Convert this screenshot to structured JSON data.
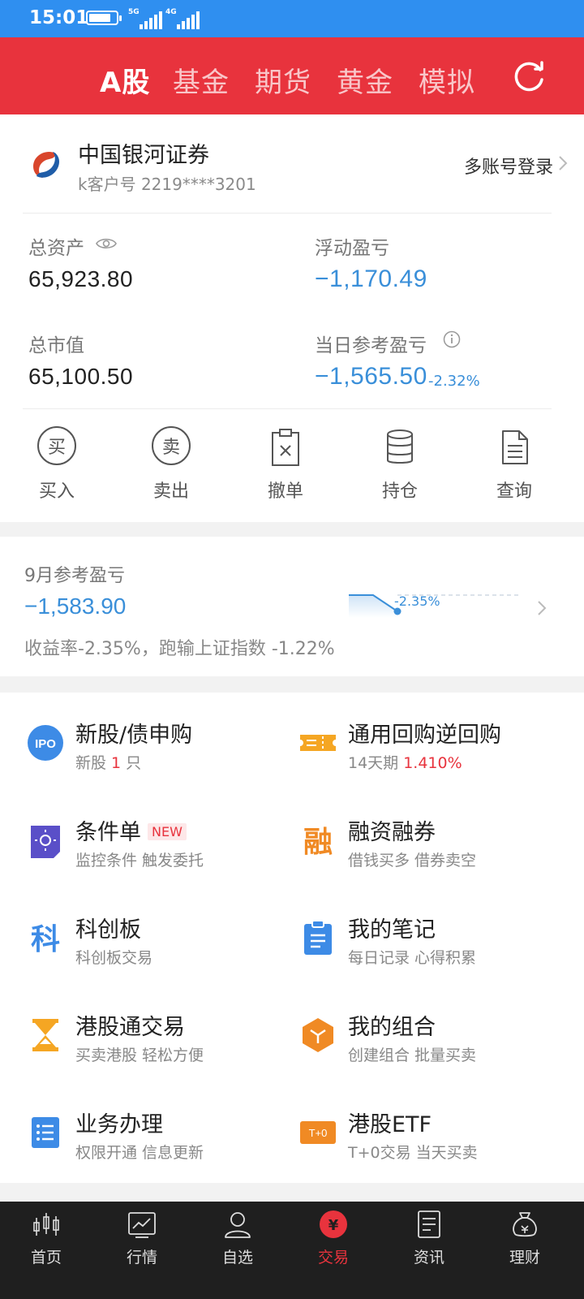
{
  "status_bar": {
    "time": "15:01",
    "network_1": "5G",
    "network_2": "4G",
    "battery_level": 0.8
  },
  "top_nav": {
    "tabs": [
      {
        "label": "A股",
        "active": true
      },
      {
        "label": "基金",
        "active": false
      },
      {
        "label": "期货",
        "active": false
      },
      {
        "label": "黄金",
        "active": false
      },
      {
        "label": "模拟",
        "active": false
      }
    ],
    "refresh_icon": "refresh-icon"
  },
  "account": {
    "broker_name": "中国银河证券",
    "account_id": "k客户号 2219****3201",
    "multi_login": "多账号登录",
    "total_assets_label": "总资产",
    "total_assets_value": "65,923.80",
    "floating_pl_label": "浮动盈亏",
    "floating_pl_value": "−1,170.49",
    "market_value_label": "总市值",
    "market_value_value": "65,100.50",
    "daily_pl_label": "当日参考盈亏",
    "daily_pl_value": "−1,565.50",
    "daily_pl_pct": "-2.32%"
  },
  "actions": [
    {
      "label": "买入",
      "glyph": "买"
    },
    {
      "label": "卖出",
      "glyph": "卖"
    },
    {
      "label": "撤单"
    },
    {
      "label": "持仓"
    },
    {
      "label": "查询"
    }
  ],
  "monthly": {
    "title": "9月参考盈亏",
    "value": "−1,583.90",
    "description": "收益率-2.35%，跑输上证指数 -1.22%",
    "spark_label": "-2.35%"
  },
  "services": [
    {
      "title": "新股/债申购",
      "sub_prefix": "新股 ",
      "sub_highlight": "1",
      "sub_suffix": " 只",
      "icon": "ipo-icon",
      "icon_text": "IPO"
    },
    {
      "title": "通用回购逆回购",
      "sub_prefix": "14天期 ",
      "sub_highlight": "1.410%",
      "sub_suffix": "",
      "icon": "ticket-icon"
    },
    {
      "title": "条件单",
      "badge": "NEW",
      "sub": "监控条件 触发委托",
      "icon": "condition-order-icon"
    },
    {
      "title": "融资融券",
      "sub": "借钱买多 借券卖空",
      "icon": "margin-icon",
      "icon_text": "融"
    },
    {
      "title": "科创板",
      "sub": "科创板交易",
      "icon": "star-market-icon",
      "icon_text": "科"
    },
    {
      "title": "我的笔记",
      "sub": "每日记录 心得积累",
      "icon": "notes-icon"
    },
    {
      "title": "港股通交易",
      "sub": "买卖港股 轻松方便",
      "icon": "hourglass-icon"
    },
    {
      "title": "我的组合",
      "sub": "创建组合 批量买卖",
      "icon": "portfolio-icon"
    },
    {
      "title": "业务办理",
      "sub": "权限开通 信息更新",
      "icon": "list-icon"
    },
    {
      "title": "港股ETF",
      "sub": "T+0交易 当天买卖",
      "icon": "t0-icon",
      "icon_text": "T+0"
    }
  ],
  "bottom_tabs": [
    {
      "label": "首页",
      "icon": "candlestick-icon",
      "active": false
    },
    {
      "label": "行情",
      "icon": "chart-icon",
      "active": false
    },
    {
      "label": "自选",
      "icon": "user-icon",
      "active": false
    },
    {
      "label": "交易",
      "icon": "yen-icon",
      "active": true,
      "icon_text": "¥"
    },
    {
      "label": "资讯",
      "icon": "document-icon",
      "active": false
    },
    {
      "label": "理财",
      "icon": "money-bag-icon",
      "active": false
    }
  ],
  "colors": {
    "status_bar": "#2f8ff0",
    "brand_red": "#e8333d",
    "negative_blue": "#3a8fd9",
    "bottom_bar": "#1f1f1f"
  }
}
